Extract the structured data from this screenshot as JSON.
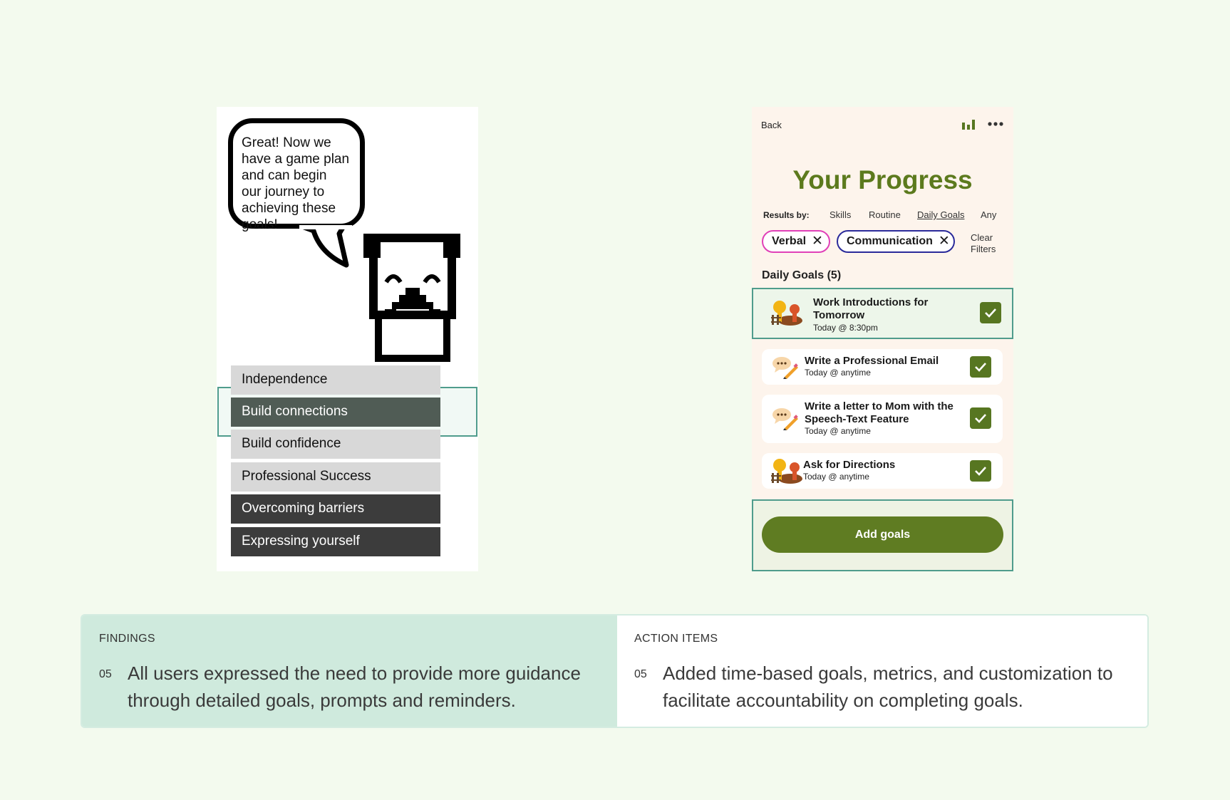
{
  "left_phone": {
    "speech": "Great! Now we have a game plan and can begin our journey to achieving these goals!",
    "options": [
      {
        "label": "Independence",
        "state": "light"
      },
      {
        "label": "Build connections",
        "state": "selected"
      },
      {
        "label": "Build confidence",
        "state": "light"
      },
      {
        "label": "Professional Success",
        "state": "light"
      },
      {
        "label": "Overcoming barriers",
        "state": "dark"
      },
      {
        "label": "Expressing yourself",
        "state": "dark"
      }
    ]
  },
  "right_phone": {
    "back": "Back",
    "title": "Your Progress",
    "results_label": "Results by:",
    "filters": [
      "Skills",
      "Routine",
      "Daily Goals",
      "Any"
    ],
    "active_filter": "Daily Goals",
    "chips": [
      "Verbal",
      "Communication"
    ],
    "clear": "Clear Filters",
    "section": "Daily Goals (5)",
    "goals": [
      {
        "title": "Work Introductions for Tomorrow",
        "time": "Today @ 8:30pm",
        "icon": "people-icon",
        "done": true
      },
      {
        "title": "Write a Professional Email",
        "time": "Today @ anytime",
        "icon": "speech-pencil-icon",
        "done": true
      },
      {
        "title": "Write a letter to Mom with the Speech-Text Feature",
        "time": "Today @ anytime",
        "icon": "speech-pencil-icon",
        "done": true
      },
      {
        "title": "Ask for Directions",
        "time": "Today @ anytime",
        "icon": "people-icon",
        "done": true
      }
    ],
    "add_button": "Add goals"
  },
  "findings": {
    "label": "FINDINGS",
    "number": "05",
    "text": "All users expressed the need to provide more guidance through detailed goals, prompts and reminders."
  },
  "actions": {
    "label": "ACTION ITEMS",
    "number": "05",
    "text": "Added time-based goals, metrics, and customization to facilitate accountability on completing goals."
  },
  "colors": {
    "background": "#f3faee",
    "accent_green": "#5f7c22",
    "highlight_border": "#4f9c8c",
    "findings_bg": "#cfeadd"
  }
}
